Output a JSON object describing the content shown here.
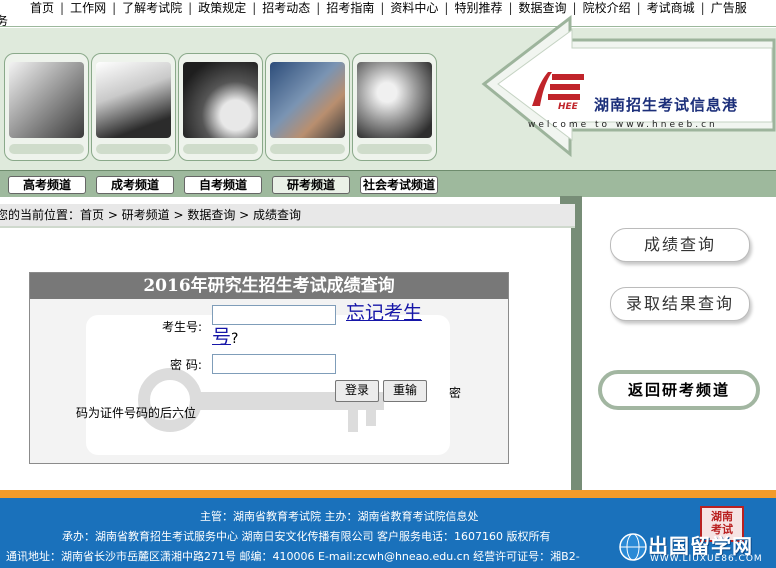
{
  "topnav": {
    "items": [
      "首页",
      "工作网",
      "了解考试院",
      "政策规定",
      "招考动态",
      "招考指南",
      "资料中心",
      "特别推荐",
      "数据查询",
      "院校介绍",
      "考试商城",
      "广告服"
    ],
    "overflow": "务"
  },
  "logo": {
    "mark": "HEE",
    "name": "湖南招生考试信息港",
    "tagline": "welcome to www.hneeb.cn"
  },
  "tabs": [
    "高考频道",
    "成考频道",
    "自考频道",
    "研考频道",
    "社会考试频道"
  ],
  "active_tab": "研考频道",
  "breadcrumb": "您的当前位置：首页 > 研考频道 > 数据查询 > 成绩查询",
  "query": {
    "title": "2016年研究生招生考试成绩查询",
    "exam_no_label": "考生号:",
    "forgot_link": "忘记考生号",
    "forgot_q": "?",
    "password_label": "密  码:",
    "login_button": "登录",
    "reset_button": "重输",
    "hint_a": "密",
    "hint_b": "码为证件号码的后六位"
  },
  "right": {
    "score_query": "成绩查询",
    "admission_query": "录取结果查询",
    "back": "返回研考频道"
  },
  "footer": {
    "line1": "主管：湖南省教育考试院      主办：湖南省教育考试院信息处",
    "line2": "承办：湖南省教育招生考试服务中心      湖南日安文化传播有限公司      客户服务电话：1607160      版权所有",
    "line3": "通讯地址：湖南省长沙市岳麓区潇湘中路271号    邮编：410006    E-mail:zcwh@hneao.edu.cn    经营许可证号：湘B2-"
  },
  "seal": "湖南考试",
  "watermark": {
    "name": "出国留学网",
    "url": "WWW.LIUXUE86.COM"
  },
  "colors": {
    "banner_bg": "#dfeadc",
    "tabs_bg": "#9eb99d",
    "panel_title_bg": "#787878",
    "footer_bg": "#1a71bb",
    "footer_stripe": "#f29b2b",
    "logo_red": "#c0242a",
    "logo_navy": "#1c2f7a",
    "link": "#1616a8"
  }
}
